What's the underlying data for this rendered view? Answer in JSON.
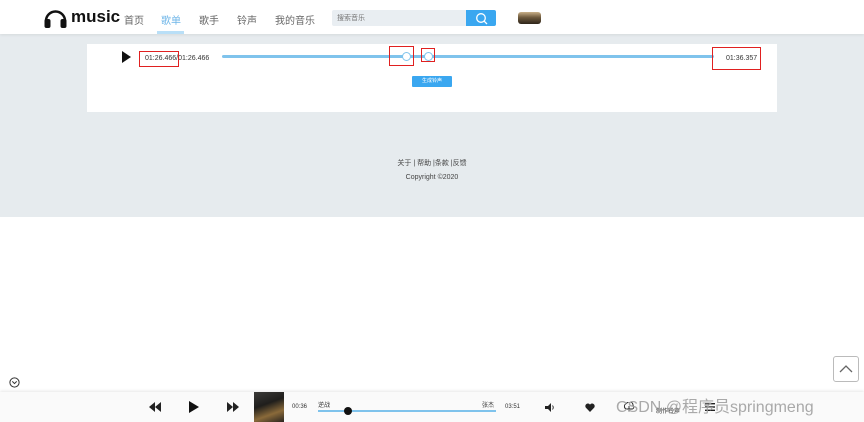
{
  "header": {
    "logo_text": "music",
    "nav": [
      "首页",
      "歌单",
      "歌手",
      "铃声",
      "我的音乐"
    ],
    "active_nav": "歌单",
    "search_placeholder": "搜索音乐"
  },
  "editor": {
    "current_time": "01:26.466",
    "total_time": "01:26.466",
    "end_time": "01:36.357",
    "generate_label": "生成铃声"
  },
  "footer": {
    "links": "关于 | 帮助 |条款 |反馈",
    "copyright": "Copyright ©2020"
  },
  "player": {
    "current_time": "00:36",
    "song_title": "逆战",
    "artist": "张杰",
    "total_time": "03:51",
    "progress": 0.17,
    "ringtone_label": "制作铃声"
  },
  "watermark": "CSDN @程序员springmeng",
  "colors": {
    "accent": "#3aa7f0",
    "track": "#7fc3ec",
    "band": "#e6ebee",
    "highlight": "#e02020"
  }
}
